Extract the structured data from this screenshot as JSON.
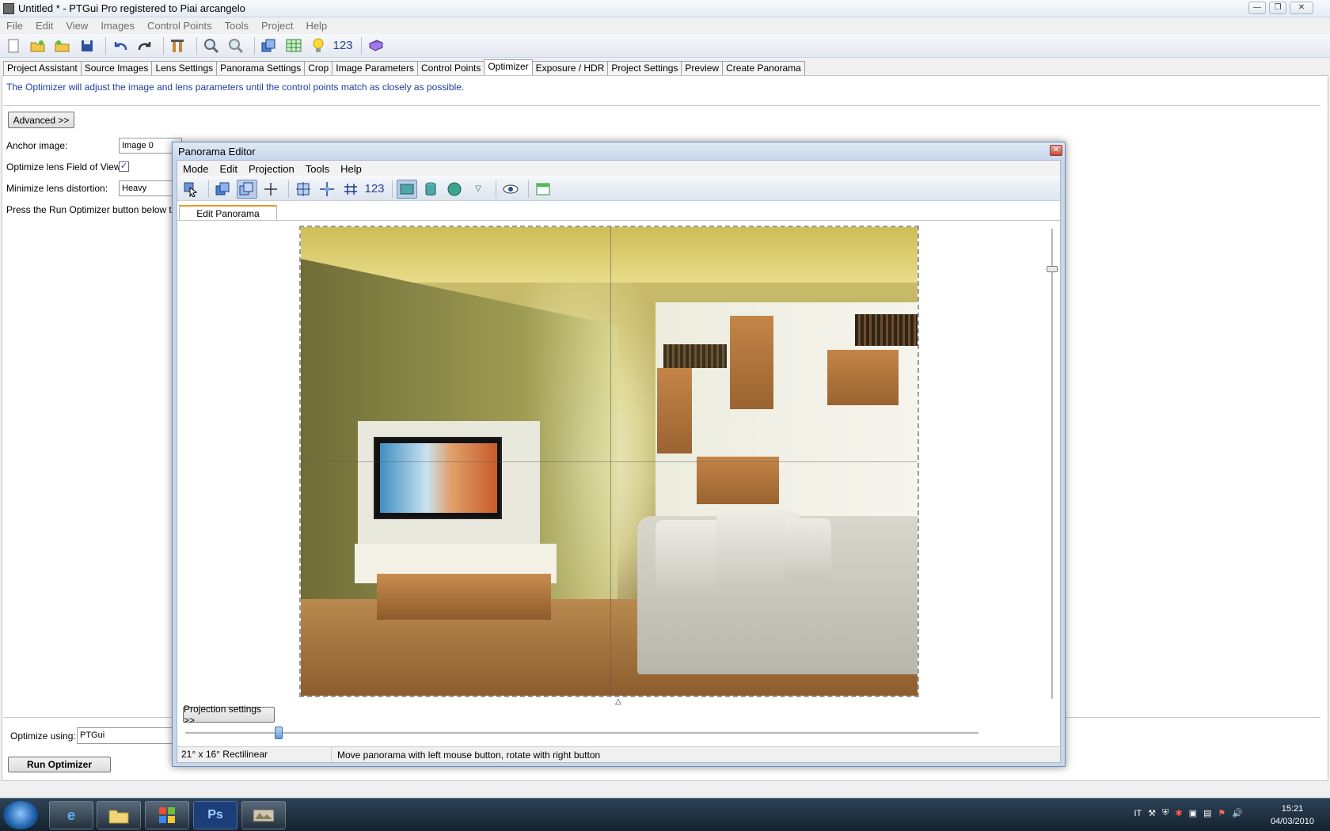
{
  "window": {
    "title": "Untitled * - PTGui Pro registered to Piai arcangelo",
    "controls": [
      "minimize",
      "restore",
      "close"
    ]
  },
  "menubar": [
    "File",
    "Edit",
    "View",
    "Images",
    "Control Points",
    "Tools",
    "Project",
    "Help"
  ],
  "toolbar": {
    "icons": [
      "new-icon",
      "open-icon",
      "open-recent-icon",
      "save-icon",
      "undo-icon",
      "redo-icon",
      "optimize-tools-icon",
      "zoom-in-icon",
      "zoom-out-icon",
      "panorama-editor-icon",
      "table-icon",
      "lightbulb-icon",
      "numbers-icon",
      "book-icon"
    ],
    "numbers_label": "123"
  },
  "tabs": [
    "Project Assistant",
    "Source Images",
    "Lens Settings",
    "Panorama Settings",
    "Crop",
    "Image Parameters",
    "Control Points",
    "Optimizer",
    "Exposure / HDR",
    "Project Settings",
    "Preview",
    "Create Panorama"
  ],
  "active_tab": "Optimizer",
  "optimizer": {
    "info": "The Optimizer will adjust the image and lens parameters until the control points match as closely as possible.",
    "advanced_button": "Advanced >>",
    "anchor_label": "Anchor image:",
    "anchor_value": "Image 0",
    "fov_label": "Optimize lens Field of View:",
    "fov_checked": "✓",
    "distortion_label": "Minimize lens distortion:",
    "distortion_value": "Heavy",
    "press_text": "Press the Run Optimizer button below to sta",
    "optimize_using_label": "Optimize using:",
    "optimize_using_value": "PTGui",
    "run_button": "Run Optimizer"
  },
  "panorama_editor": {
    "title": "Panorama Editor",
    "close": "✕",
    "menubar": [
      "Mode",
      "Edit",
      "Projection",
      "Tools",
      "Help"
    ],
    "numbers_label": "123",
    "tab": "Edit Panorama",
    "projection_button": "Projection settings >>",
    "status_fov": "21° x 16° Rectilinear",
    "status_hint": "Move panorama with left mouse button, rotate with right button"
  },
  "taskbar": {
    "language": "IT",
    "time": "15:21",
    "date": "04/03/2010",
    "photoshop_label": "Ps"
  },
  "colors": {
    "info_text": "#1b3f9b",
    "active_tab_accent": "#e59a2a"
  }
}
